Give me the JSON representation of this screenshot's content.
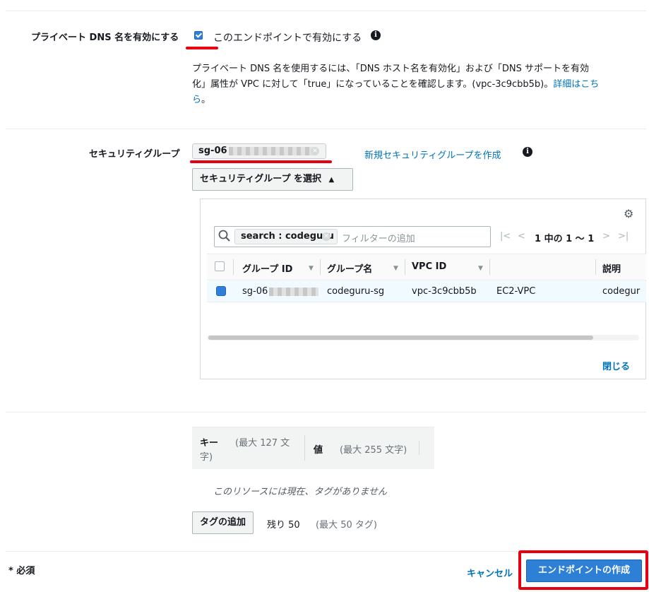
{
  "private_dns": {
    "label": "プライベート DNS 名を有効にする",
    "checkbox_label": "このエンドポイントで有効にする",
    "checked": true,
    "description_line1": "プライベート DNS 名を使用するには、「DNS ホスト名を有効化」および「DNS サポートを有効",
    "description_line2_a": "化」属性が VPC に対して「true」になっていることを確認します。(vpc-3c9cbb5b)。",
    "description_link_a": "詳細はこち",
    "description_link_b": "ら",
    "description_end": "。"
  },
  "security_group": {
    "label": "セキュリティグループ",
    "selected_token": "sg-06",
    "create_link": "新規セキュリティグループを作成",
    "select_button": "セキュリティグループ を選択",
    "select_button_icon": "caret-up-icon"
  },
  "picker": {
    "settings_icon": "gear-icon",
    "search_icon": "search-icon",
    "filter_chip": "search : codeguru",
    "filter_placeholder": "フィルターの追加",
    "page_info": "1 中の 1 〜 1",
    "columns": [
      "グループ ID",
      "グループ名",
      "VPC ID",
      "",
      "説明"
    ],
    "rows": [
      {
        "group_id": "sg-06",
        "group_name": "codeguru-sg",
        "vpc_id": "vpc-3c9cbb5b",
        "type": "EC2-VPC",
        "description": "codeguru",
        "selected": true
      }
    ],
    "close_link": "閉じる"
  },
  "tags": {
    "key_header": "キー",
    "key_hint": "(最大 127 文",
    "key_hint_cont": "字)",
    "value_header": "値",
    "value_hint": "(最大 255 文字)",
    "empty_message": "このリソースには現在、タグがありません",
    "add_button": "タグの追加",
    "remaining": "残り 50",
    "remaining_hint": "(最大 50 タグ)"
  },
  "footer": {
    "required_note": "* 必須",
    "cancel": "キャンセル",
    "create": "エンドポイントの作成"
  },
  "colors": {
    "accent": "#0073bb",
    "primary_button": "#2e7fd6",
    "highlight_red": "#e60012"
  }
}
